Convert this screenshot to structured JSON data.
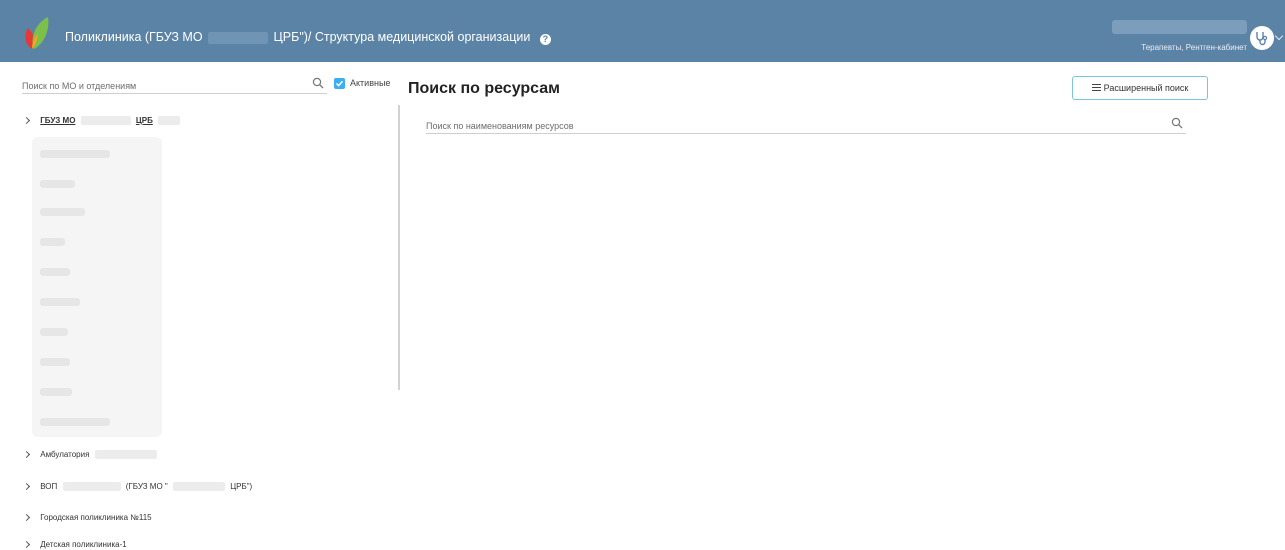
{
  "header": {
    "title_part1": "Поликлиника (ГБУЗ МО",
    "title_part2": "ЦРБ\")/ Структура медицинской организации",
    "user_role": "Терапевты, Рентген-кабинет",
    "colors": {
      "bar": "#5b83a6",
      "accent": "#3daeef"
    }
  },
  "sidebar": {
    "search_placeholder": "Поиск по МО и отделениям",
    "active_label": "Активные",
    "tree": [
      {
        "label_a": "ГБУЗ МО",
        "label_b": "ЦРБ"
      },
      {
        "label": "Амбулатория"
      },
      {
        "label_a": "ВОП",
        "label_b": "(ГБУЗ МО \"",
        "label_c": "ЦРБ\")"
      },
      {
        "label": "Городская поликлиника №115"
      },
      {
        "label": "Детская поликлиника-1"
      }
    ]
  },
  "main": {
    "title": "Поиск по ресурсам",
    "advanced_search_label": "Расширенный поиск",
    "resource_search_placeholder": "Поиск по наименованиям ресурсов"
  }
}
